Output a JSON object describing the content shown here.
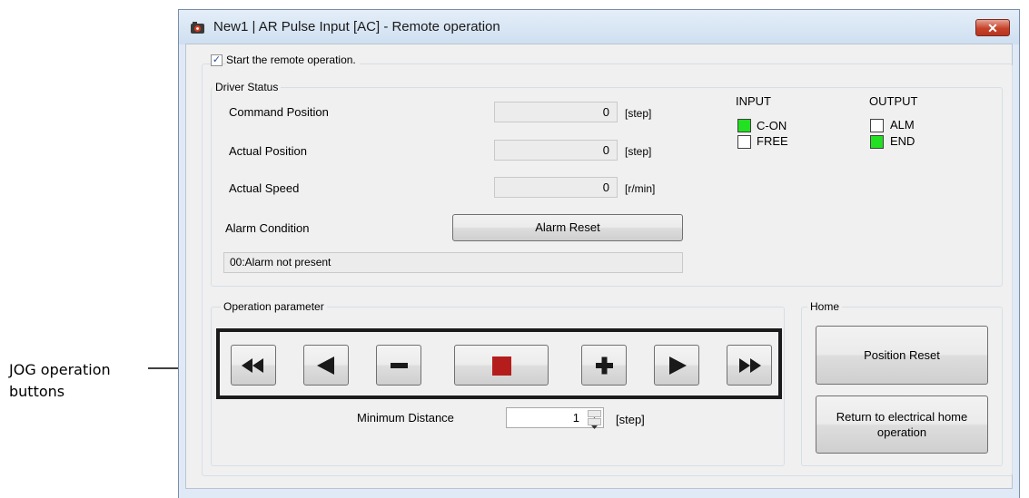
{
  "annotation": {
    "label_line1": "JOG operation",
    "label_line2": "buttons"
  },
  "window": {
    "title": "New1 | AR Pulse Input [AC] - Remote operation",
    "close_icon": "close-x-icon"
  },
  "remote": {
    "checkbox_label": "Start the remote operation.",
    "checked": true
  },
  "driver_status": {
    "caption": "Driver Status",
    "rows": [
      {
        "label": "Command Position",
        "value": "0",
        "unit": "[step]"
      },
      {
        "label": "Actual Position",
        "value": "0",
        "unit": "[step]"
      },
      {
        "label": "Actual Speed",
        "value": "0",
        "unit": "[r/min]"
      }
    ],
    "alarm_label": "Alarm Condition",
    "alarm_reset": "Alarm Reset",
    "alarm_status": "00:Alarm not present",
    "input_title": "INPUT",
    "output_title": "OUTPUT",
    "inputs": [
      {
        "name": "C-ON",
        "on": true
      },
      {
        "name": "FREE",
        "on": false
      }
    ],
    "outputs": [
      {
        "name": "ALM",
        "on": false
      },
      {
        "name": "END",
        "on": true
      }
    ],
    "on_color": "#22e022"
  },
  "operation": {
    "caption": "Operation parameter",
    "jog_buttons": [
      "fast-reverse-icon",
      "reverse-icon",
      "minus-icon",
      "stop-icon",
      "plus-icon",
      "forward-icon",
      "fast-forward-icon"
    ],
    "min_distance_label": "Minimum Distance",
    "min_distance_value": "1",
    "min_distance_unit": "[step]",
    "stop_color": "#b51d1d"
  },
  "home": {
    "caption": "Home",
    "position_reset": "Position Reset",
    "return_home": "Return to electrical home operation"
  }
}
